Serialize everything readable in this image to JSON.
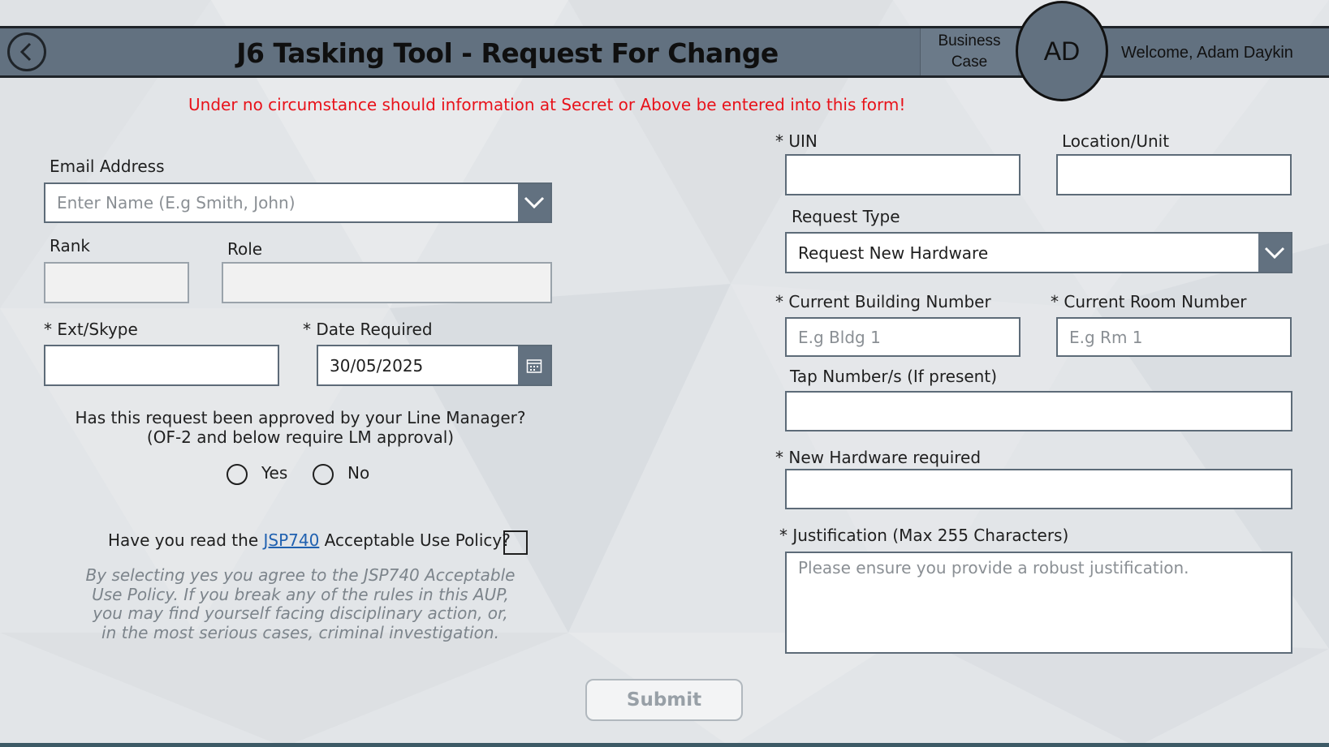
{
  "header": {
    "title": "J6 Tasking Tool - Request For Change",
    "business_case_line1": "Business",
    "business_case_line2": "Case",
    "avatar_initials": "AD",
    "welcome": "Welcome, Adam Daykin"
  },
  "warning": "Under no circumstance should information at Secret or Above be entered into this form!",
  "left": {
    "email_label": "Email Address",
    "email_placeholder": "Enter Name (E.g Smith, John)",
    "rank_label": "Rank",
    "role_label": "Role",
    "ext_label": "* Ext/Skype",
    "date_label": "* Date Required",
    "date_value": "30/05/2025",
    "approval_question_line1": "Has this request been approved by your Line Manager?",
    "approval_question_line2": "(OF-2 and below require LM approval)",
    "yes_label": "Yes",
    "no_label": "No",
    "aup_prefix": "Have you read the ",
    "aup_link": "JSP740",
    "aup_suffix": " Acceptable Use Policy?",
    "disclaimer_lines": [
      "By selecting yes you agree to the JSP740 Acceptable",
      "Use Policy. If you break any of the rules in this AUP,",
      "you may find yourself facing disciplinary action, or,",
      "in the most serious cases, criminal investigation."
    ]
  },
  "right": {
    "uin_label": "* UIN",
    "location_label": "Location/Unit",
    "request_type_label": "Request Type",
    "request_type_value": "Request New Hardware",
    "building_label": "* Current Building Number",
    "building_placeholder": "E.g Bldg 1",
    "room_label": "* Current Room Number",
    "room_placeholder": "E.g Rm 1",
    "tap_label": "Tap Number/s (If present)",
    "hardware_label": "* New Hardware required",
    "justification_label": "* Justification (Max 255 Characters)",
    "justification_placeholder": "Please ensure you provide a robust justification."
  },
  "submit_label": "Submit",
  "icons": {
    "back": "chevron-left-circle-icon",
    "dropdown": "chevron-down-icon",
    "calendar": "calendar-icon"
  },
  "colors": {
    "header": "#627180",
    "warning": "#e8121a",
    "link": "#2061b0"
  }
}
